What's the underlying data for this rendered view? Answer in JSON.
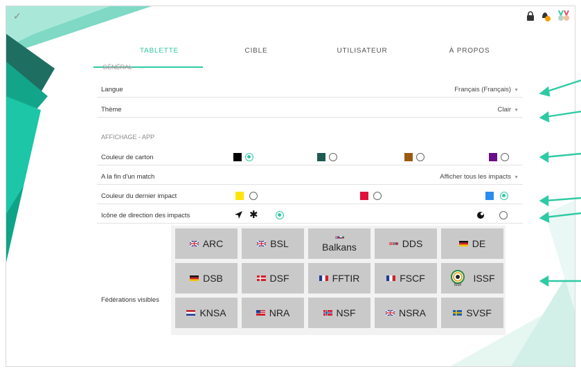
{
  "tabs": [
    "TABLETTE",
    "CIBLE",
    "UTILISATEUR",
    "À PROPOS"
  ],
  "sections": {
    "general": "GÉNÉRAL",
    "display": "AFFICHAGE - APP"
  },
  "rows": {
    "language": {
      "label": "Langue",
      "value": "Français (Français)"
    },
    "theme": {
      "label": "Thème",
      "value": "Clair"
    },
    "card_color": {
      "label": "Couleur de carton",
      "options": [
        "#000000",
        "#1d5a52",
        "#9a5a12",
        "#6a0e8a"
      ],
      "selected": 0
    },
    "end_of_match": {
      "label": "A la fin d'un match",
      "value": "Afficher tous les impacts"
    },
    "last_impact_color": {
      "label": "Couleur du dernier impact",
      "options": [
        "#ffe40a",
        "#e0103a",
        "#2a8cf0"
      ],
      "selected": 2
    },
    "impact_direction_icon": {
      "label": "Icône de direction des impacts"
    }
  },
  "federations_label": "Fédérations visibles",
  "federations": [
    {
      "name": "ARC",
      "flag": "uk"
    },
    {
      "name": "BSL",
      "flag": "uk"
    },
    {
      "name": "Balkans",
      "flag": "balkans"
    },
    {
      "name": "DDS",
      "flag": "nordic"
    },
    {
      "name": "DE",
      "flag": "de"
    },
    {
      "name": "DSB",
      "flag": "de"
    },
    {
      "name": "DSF",
      "flag": "dk"
    },
    {
      "name": "FFTIR",
      "flag": "fr"
    },
    {
      "name": "FSCF",
      "flag": "fr"
    },
    {
      "name": "ISSF",
      "flag": "issf"
    },
    {
      "name": "KNSA",
      "flag": "nl"
    },
    {
      "name": "NRA",
      "flag": "us"
    },
    {
      "name": "NSF",
      "flag": "no"
    },
    {
      "name": "NSRA",
      "flag": "uk"
    },
    {
      "name": "SVSF",
      "flag": "se"
    }
  ],
  "accent_color": "#2fcaa4"
}
